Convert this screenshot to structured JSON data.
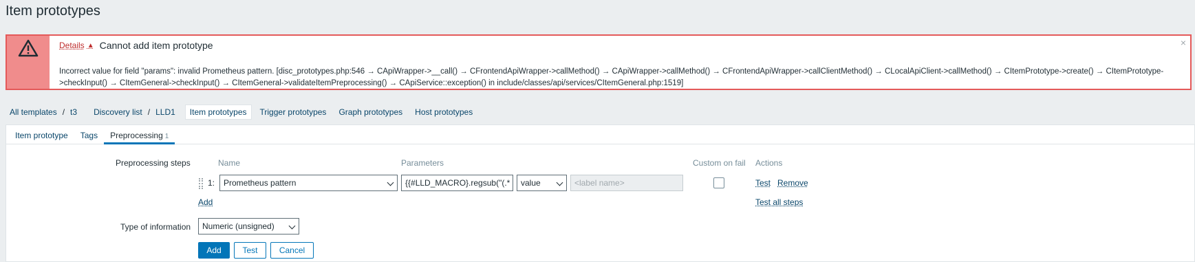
{
  "page": {
    "title": "Item prototypes"
  },
  "message": {
    "icon": "warning-icon",
    "details_label": "Details",
    "title": "Cannot add item prototype",
    "detail": "Incorrect value for field \"params\": invalid Prometheus pattern. [disc_prototypes.php:546 → CApiWrapper->__call() → CFrontendApiWrapper->callMethod() → CApiWrapper->callMethod() → CFrontendApiWrapper->callClientMethod() → CLocalApiClient->callMethod() → CItemPrototype->create() → CItemPrototype->checkInput() → CItemGeneral->checkInput() → CItemGeneral->validateItemPreprocessing() → CApiService::exception() in include/classes/api/services/CItemGeneral.php:1519]",
    "close": "×",
    "colors": {
      "border": "#e45959",
      "icon_bg": "#f08c8c"
    }
  },
  "breadcrumbs": {
    "all_templates": "All templates",
    "sep": "/",
    "template": "t3",
    "discovery_list": "Discovery list",
    "lld": "LLD1",
    "item_prototypes": "Item prototypes",
    "trigger_prototypes": "Trigger prototypes",
    "graph_prototypes": "Graph prototypes",
    "host_prototypes": "Host prototypes"
  },
  "tabs": {
    "item_prototype": "Item prototype",
    "tags": "Tags",
    "preprocessing": "Preprocessing",
    "preprocessing_count": "1"
  },
  "form": {
    "preprocessing_label": "Preprocessing steps",
    "columns": {
      "name": "Name",
      "parameters": "Parameters",
      "custom_on_fail": "Custom on fail",
      "actions": "Actions"
    },
    "step": {
      "number": "1:",
      "name": "Prometheus pattern",
      "param": "{{#LLD_MACRO}.regsub(\"(.*",
      "value_type": "value",
      "label_placeholder": "<label name>"
    },
    "test_link": "Test",
    "remove_link": "Remove",
    "add_link": "Add",
    "test_all_link": "Test all steps",
    "type_label": "Type of information",
    "type_value": "Numeric (unsigned)",
    "add_button": "Add",
    "test_button": "Test",
    "cancel_button": "Cancel"
  }
}
